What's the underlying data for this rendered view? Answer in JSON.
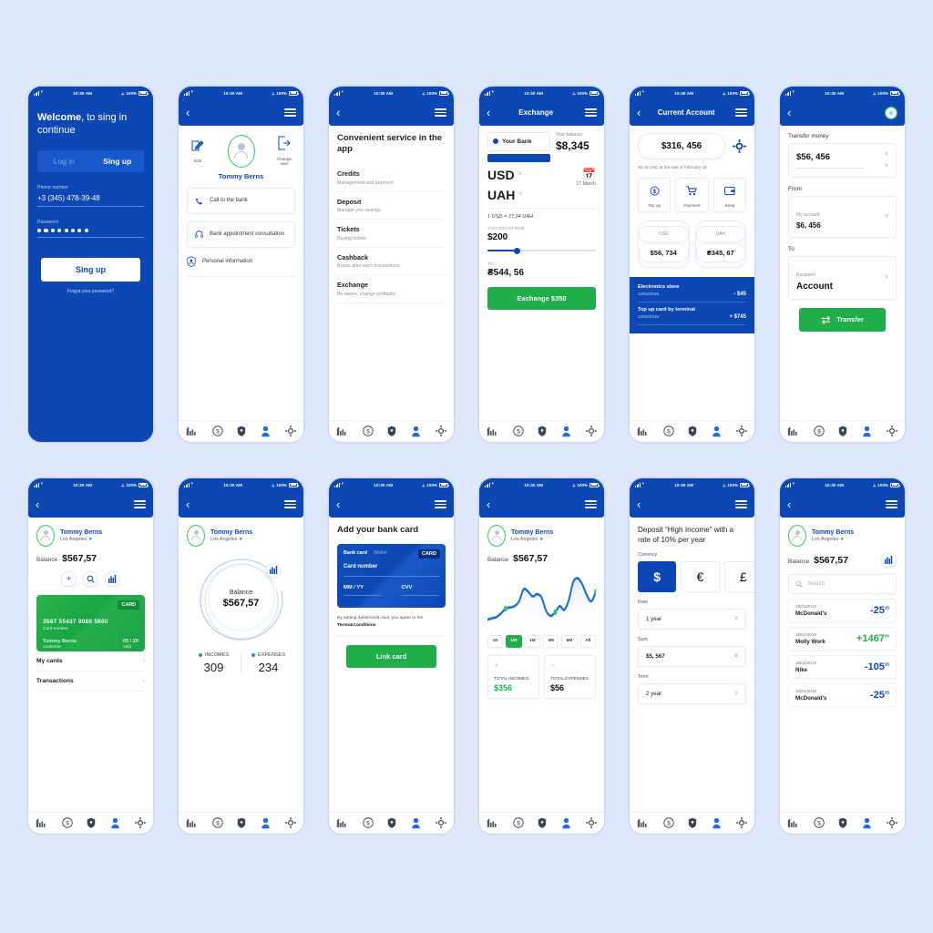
{
  "status_bar": {
    "time": "10:30 AM",
    "battery": "100%"
  },
  "tabbar": {
    "items": [
      "chart-icon",
      "dollar-icon",
      "shield-icon",
      "person-icon",
      "gear-icon"
    ],
    "active": "person-icon"
  },
  "screen_login": {
    "title_bold": "Welcome",
    "title_rest": ", to sing in continue",
    "tabs": [
      {
        "label": "Log in",
        "active": false
      },
      {
        "label": "Sing up",
        "active": true
      }
    ],
    "phone_label": "Phone number",
    "phone_value": "+3 (345) 478-39-48",
    "password_label": "Password",
    "password_masked": "●●●●●●●●",
    "submit": "Sing up",
    "forgot": "Forgot your password?"
  },
  "screen_profile": {
    "edit_label": "Edit",
    "change_user_label": "Change user",
    "name": "Tommy Berns",
    "rows": [
      {
        "label": "Call to the bank",
        "icon": "phone-icon"
      },
      {
        "label": "Bank appointment consultation",
        "icon": "headset-icon"
      },
      {
        "label": "Personal information",
        "icon": "person-badge-icon"
      }
    ]
  },
  "screen_services": {
    "title": "Convenient service in the app",
    "items": [
      {
        "title": "Credits",
        "subtitle": "Management and payment"
      },
      {
        "title": "Deposit",
        "subtitle": "Manage you savings"
      },
      {
        "title": "Tickets",
        "subtitle": "Buying tickets"
      },
      {
        "title": "Cashback",
        "subtitle": "Bonus after each transactions"
      },
      {
        "title": "Exchange",
        "subtitle": "Be aware, change profitably"
      }
    ]
  },
  "screen_exchange": {
    "nav_title": "Exchange",
    "bank_label": "Your Bank",
    "balance_label": "Your balance",
    "balance_value": "$8,345",
    "currency_from": "USD",
    "currency_to": "UAH",
    "date": "17 March",
    "rate": "1 USD = 27,34 UAH",
    "you_exchange_label": "YOU EXCHANGE",
    "you_exchange_value": "$200",
    "to_label": "TO",
    "to_value": "₴544, 56",
    "cta": "Exchange $350",
    "slider_percent": 26
  },
  "screen_account": {
    "nav_title": "Current Account",
    "amount": "$316, 456",
    "note": "45,45 USD at the rate of February 18",
    "actions": [
      {
        "label": "Top up",
        "icon": "dollar-circle-icon"
      },
      {
        "label": "Payment",
        "icon": "cart-icon"
      },
      {
        "label": "Send",
        "icon": "send-card-icon"
      }
    ],
    "currencies": [
      {
        "code": "USD",
        "value": "$56, 734"
      },
      {
        "code": "UAH",
        "value": "₴345, 67"
      }
    ],
    "transactions": [
      {
        "title": "Electronics store",
        "date": "12/02/2019",
        "amount": "- $45"
      },
      {
        "title": "Top up card by terminal",
        "date": "12/02/2019",
        "amount": "+ $745"
      }
    ]
  },
  "screen_transfer": {
    "title": "Transfer money",
    "amount": "$56, 456",
    "from_label": "From",
    "from_sub": "My account",
    "from_value": "$6, 456",
    "to_label": "To",
    "to_sub": "Recipient",
    "to_value": "Account",
    "cta": "Transfer"
  },
  "screen_cards": {
    "name": "Tommy Berns",
    "location": "Los Angeles",
    "balance_label": "Balance",
    "balance_value": "$567,57",
    "quick_actions": [
      "plus-icon",
      "search-icon",
      "chart-icon"
    ],
    "card": {
      "tag": "CARD",
      "number": "3567 55437 9080 5600",
      "number_caption": "Card number",
      "holder": "Tommy Berns",
      "holder_caption": "cardholder",
      "valid": "05 / 20",
      "valid_caption": "valid"
    },
    "rows": [
      "My cards",
      "Transactions"
    ]
  },
  "screen_donut": {
    "name": "Tommy Berns",
    "location": "Los Angeles",
    "donut_label": "Balance",
    "donut_value": "$567,57",
    "incomes_label": "INCOMES",
    "incomes_value": "309",
    "expenses_label": "EXPENSES",
    "expenses_value": "234"
  },
  "screen_addcard": {
    "title": "Add your bank card",
    "tab_bank": "Bank card",
    "tab_wallet": "Wallet",
    "tag": "CARD",
    "card_number_label": "Card number",
    "mmyy_label": "MM / YY",
    "cvv_label": "CVV",
    "terms_text": "By adding debit/credit card, you agree to the ",
    "terms_link": "Terms&Conditions",
    "cta": "Link card"
  },
  "screen_chart": {
    "name": "Tommy Berns",
    "location": "Los Angeles",
    "balance_label": "Balance",
    "balance_value": "$567,57",
    "ranges": [
      {
        "label": "1D",
        "active": false
      },
      {
        "label": "1W",
        "active": true
      },
      {
        "label": "1M",
        "active": false
      },
      {
        "label": "3M",
        "active": false
      },
      {
        "label": "6M",
        "active": false
      },
      {
        "label": "All",
        "active": false
      }
    ],
    "total_incomes_label": "TOTAL INCOMES",
    "total_incomes_value": "$356",
    "total_expenses_label": "TOTAL EXPENSES",
    "total_expenses_value": "$56"
  },
  "screen_deposit": {
    "title": "Deposit “High Income” with a rate of 10% per year",
    "currency_label": "Currency",
    "currencies": [
      {
        "symbol": "$",
        "active": true
      },
      {
        "symbol": "€",
        "active": false
      },
      {
        "symbol": "£",
        "active": false
      }
    ],
    "rate_label": "Rate",
    "rate_value": "1 year",
    "sum_label": "Sum",
    "sum_value": "$5, 567",
    "term_label": "Term",
    "term_value": "2 year"
  },
  "screen_transactions": {
    "name": "Tommy Berns",
    "location": "Los Angeles",
    "balance_label": "Balance",
    "balance_value": "$567,57",
    "search_placeholder": "Search",
    "items": [
      {
        "date": "18/01/2019",
        "merchant": "McDonald's",
        "amount": "-25",
        "cents": "25",
        "positive": false
      },
      {
        "date": "18/01/2019",
        "merchant": "Molly Work",
        "amount": "+1467",
        "cents": "00",
        "positive": true
      },
      {
        "date": "18/01/2019",
        "merchant": "Nike",
        "amount": "-105",
        "cents": "25",
        "positive": false
      },
      {
        "date": "18/01/2019",
        "merchant": "McDonald's",
        "amount": "-25",
        "cents": "25",
        "positive": false
      }
    ]
  },
  "chart_data": {
    "type": "line",
    "title": "",
    "x": [
      0,
      1,
      2,
      3,
      4,
      5,
      6,
      7,
      8,
      9,
      10,
      11,
      12,
      13,
      14,
      15,
      16,
      17,
      18,
      19,
      20,
      21,
      22,
      23,
      24
    ],
    "series": [
      {
        "name": "Balance",
        "values": [
          12,
          14,
          16,
          22,
          30,
          32,
          34,
          42,
          62,
          58,
          50,
          54,
          48,
          26,
          18,
          24,
          34,
          28,
          44,
          74,
          80,
          70,
          52,
          42,
          58
        ]
      }
    ],
    "ylim": [
      0,
      90
    ],
    "grid": false,
    "legend": "none",
    "markers": [
      {
        "x": 4,
        "y": 30
      },
      {
        "x": 15,
        "y": 24
      },
      {
        "x": 24,
        "y": 58
      }
    ],
    "accent": "#1a6ee0",
    "marker_color": "#2fcc55"
  },
  "colors": {
    "brand_blue": "#0d47b4",
    "green": "#1fae4a",
    "page_bg": "#dfe8fb",
    "accent_line": "#1a6ee0"
  }
}
